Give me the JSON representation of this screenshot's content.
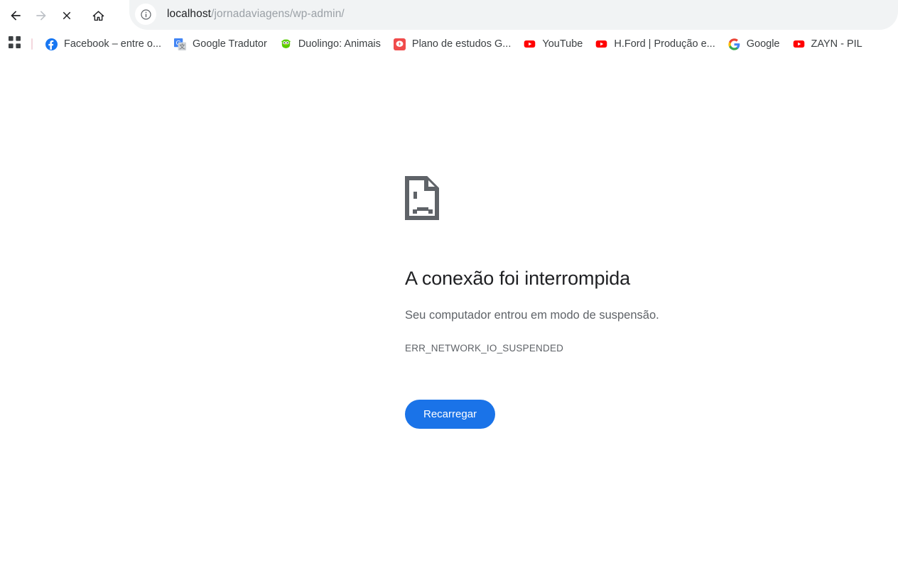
{
  "browser": {
    "toolbar": {
      "back_label": "Voltar",
      "forward_label": "Avançar",
      "stop_label": "Parar",
      "home_label": "Página inicial",
      "site_info_label": "Informações do site",
      "url_host": "localhost",
      "url_path": "/jornadaviagens/wp-admin/",
      "url_full": "localhost/jornadaviagens/wp-admin/"
    },
    "bookmarks_bar": {
      "apps_label": "Apps",
      "items": [
        {
          "label": "Facebook – entre o...",
          "icon": "facebook-icon"
        },
        {
          "label": "Google Tradutor",
          "icon": "google-translate-icon"
        },
        {
          "label": "Duolingo: Animais",
          "icon": "duolingo-icon"
        },
        {
          "label": "Plano de estudos G...",
          "icon": "plano-estudos-icon"
        },
        {
          "label": "YouTube",
          "icon": "youtube-icon"
        },
        {
          "label": "H.Ford | Produção e...",
          "icon": "youtube-icon"
        },
        {
          "label": "Google",
          "icon": "google-icon"
        },
        {
          "label": "ZAYN - PIL",
          "icon": "youtube-icon"
        }
      ]
    }
  },
  "error_page": {
    "icon": "sad-page-icon",
    "title": "A conexão foi interrompida",
    "message": "Seu computador entrou em modo de suspensão.",
    "code": "ERR_NETWORK_IO_SUSPENDED",
    "reload_button": "Recarregar"
  },
  "colors": {
    "accent": "#1a73e8",
    "omnibox_bg": "#f1f3f4",
    "text_primary": "#202124",
    "text_secondary": "#5f6368",
    "icon_grey": "#5f6368"
  }
}
